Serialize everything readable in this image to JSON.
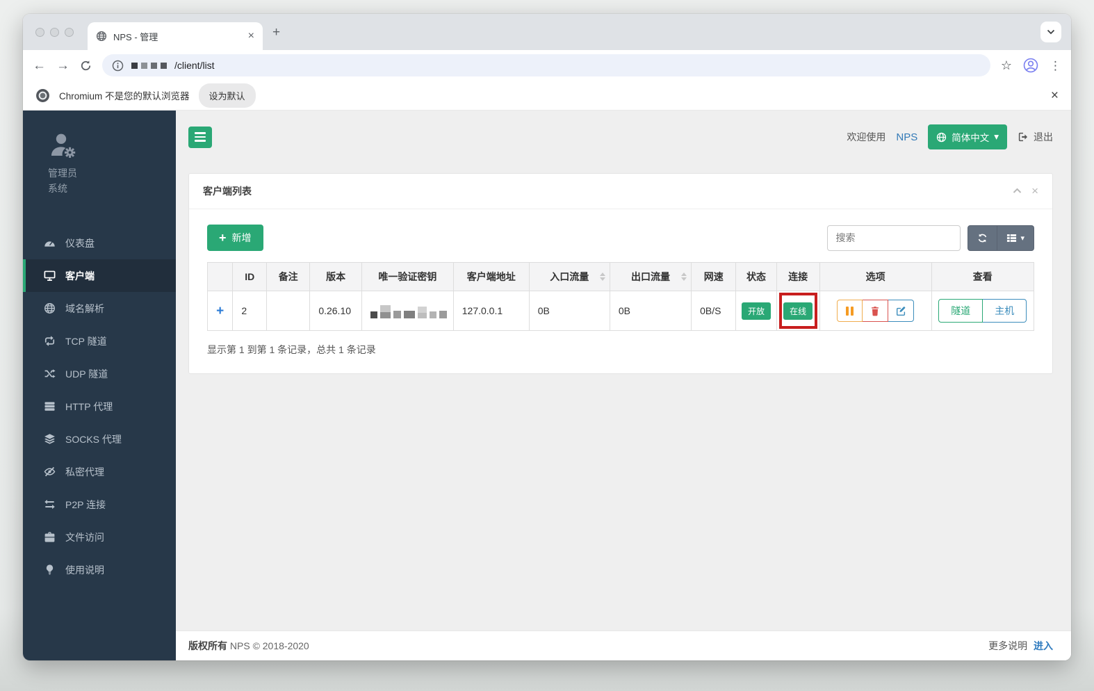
{
  "browser": {
    "tab_title": "NPS - 管理",
    "url_path": "/client/list",
    "notification": {
      "text": "Chromium 不是您的默认浏览器",
      "action": "设为默认"
    }
  },
  "icons": {
    "close": "×",
    "new_tab": "+",
    "back": "←",
    "forward": "→",
    "star": "☆",
    "dots": "⋮",
    "caret_down": "▾"
  },
  "header": {
    "welcome": "欢迎使用",
    "brand": "NPS",
    "language": "简体中文",
    "logout": "退出"
  },
  "sidebar": {
    "user": {
      "role": "管理员",
      "name": "系统"
    },
    "items": [
      {
        "label": "仪表盘",
        "icon": "tachometer-icon",
        "active": false
      },
      {
        "label": "客户端",
        "icon": "desktop-icon",
        "active": true
      },
      {
        "label": "域名解析",
        "icon": "globe-icon",
        "active": false
      },
      {
        "label": "TCP 隧道",
        "icon": "retweet-icon",
        "active": false
      },
      {
        "label": "UDP 隧道",
        "icon": "shuffle-icon",
        "active": false
      },
      {
        "label": "HTTP 代理",
        "icon": "server-icon",
        "active": false
      },
      {
        "label": "SOCKS 代理",
        "icon": "layers-icon",
        "active": false
      },
      {
        "label": "私密代理",
        "icon": "eye-slash-icon",
        "active": false
      },
      {
        "label": "P2P 连接",
        "icon": "exchange-icon",
        "active": false
      },
      {
        "label": "文件访问",
        "icon": "briefcase-icon",
        "active": false
      },
      {
        "label": "使用说明",
        "icon": "lightbulb-icon",
        "active": false
      }
    ]
  },
  "panel": {
    "title": "客户端列表",
    "add_label": "新增",
    "search_placeholder": "搜索",
    "table": {
      "columns": [
        "",
        "ID",
        "备注",
        "版本",
        "唯一验证密钥",
        "客户端地址",
        "入口流量",
        "出口流量",
        "网速",
        "状态",
        "连接",
        "选项",
        "查看"
      ],
      "rows": [
        {
          "expand": "+",
          "id": "2",
          "remark": "",
          "version": "0.26.10",
          "address": "127.0.0.1",
          "traffic_in": "0B",
          "traffic_out": "0B",
          "speed": "0B/S",
          "status": "开放",
          "connection": "在线",
          "view_tunnel": "隧道",
          "view_host": "主机"
        }
      ]
    },
    "summary": "显示第 1 到第 1 条记录，总共 1 条记录"
  },
  "footer": {
    "copyright_label": "版权所有",
    "copyright_rest": "NPS © 2018-2020",
    "more_label": "更多说明",
    "enter_label": "进入"
  },
  "colors": {
    "accent_green": "#2aa875",
    "sidebar_dark": "#273849",
    "link_blue": "#337ab7",
    "info_blue": "#3c8dbc",
    "warning_orange": "#f0ad4e",
    "danger_red": "#d9534f",
    "annotation_red": "#c81e1e"
  }
}
